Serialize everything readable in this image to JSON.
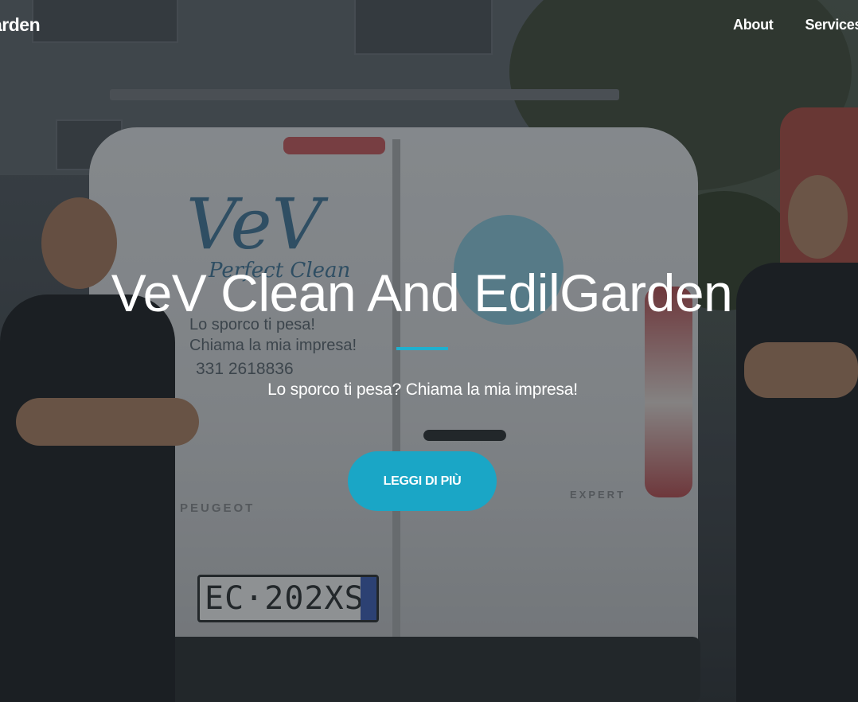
{
  "header": {
    "logo_text": "arden",
    "nav": [
      {
        "label": "About"
      },
      {
        "label": "Services"
      }
    ]
  },
  "hero": {
    "title": "VeV Clean And EdilGarden",
    "subtitle": "Lo sporco ti pesa? Chiama la mia impresa!",
    "cta_label": "LEGGI DI PIÙ",
    "accent_color": "#1aa6c6"
  },
  "background_photo": {
    "van_logo": "VeV",
    "van_logo_sub": "Perfect Clean",
    "van_slogan_1": "Lo sporco ti pesa!",
    "van_slogan_2": "Chiama la mia impresa!",
    "van_phone": "331 2618836",
    "van_brand": "PEUGEOT",
    "van_model": "EXPERT",
    "plate": "EC·202XS"
  }
}
